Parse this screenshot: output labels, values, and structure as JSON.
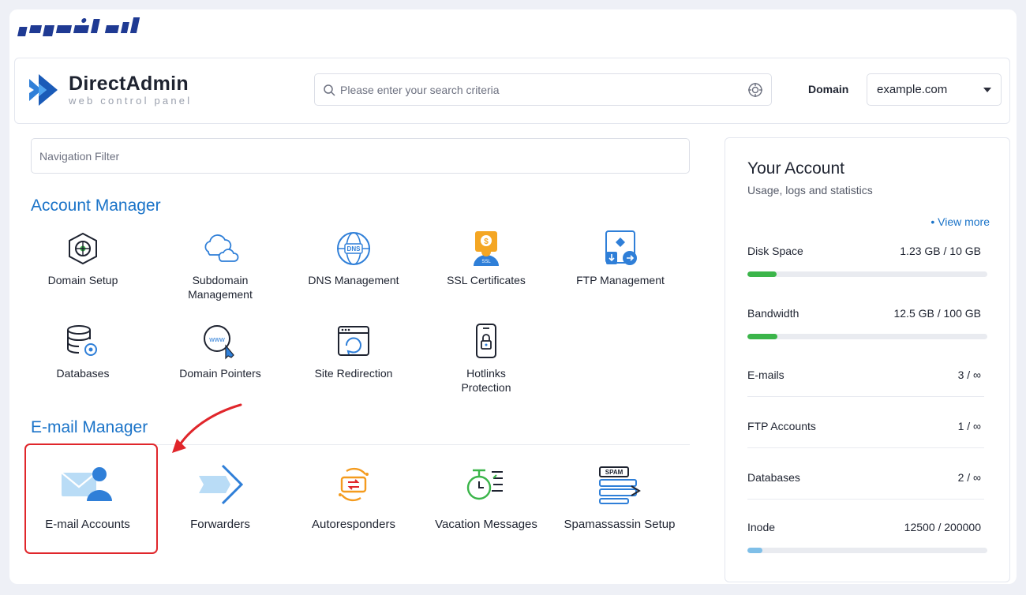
{
  "brand": {
    "logo_text": "ایران سرور"
  },
  "header": {
    "app_name": "DirectAdmin",
    "app_subtitle": "web control panel",
    "search_placeholder": "Please enter your search criteria",
    "domain_label": "Domain",
    "domain_value": "example.com"
  },
  "nav_filter_placeholder": "Navigation Filter",
  "account_manager": {
    "title": "Account Manager",
    "items": [
      {
        "label": "Domain Setup",
        "icon": "domain-setup-icon"
      },
      {
        "label": "Subdomain Management",
        "icon": "cloud-icon"
      },
      {
        "label": "DNS Management",
        "icon": "dns-globe-icon"
      },
      {
        "label": "SSL Certificates",
        "icon": "ssl-certificate-icon"
      },
      {
        "label": "FTP Management",
        "icon": "ftp-transfer-icon"
      },
      {
        "label": "Databases",
        "icon": "database-icon"
      },
      {
        "label": "Domain Pointers",
        "icon": "www-pointer-icon"
      },
      {
        "label": "Site Redirection",
        "icon": "redirect-icon"
      },
      {
        "label": "Hotlinks Protection",
        "icon": "lock-phone-icon"
      }
    ]
  },
  "email_manager": {
    "title": "E-mail Manager",
    "items": [
      {
        "label": "E-mail Accounts",
        "icon": "email-accounts-icon"
      },
      {
        "label": "Forwarders",
        "icon": "forward-arrow-icon"
      },
      {
        "label": "Autoresponders",
        "icon": "autoresponder-icon"
      },
      {
        "label": "Vacation Messages",
        "icon": "vacation-clock-icon"
      },
      {
        "label": "Spamassassin Setup",
        "icon": "spam-filter-icon"
      }
    ]
  },
  "your_account": {
    "title": "Your Account",
    "subtitle": "Usage, logs and statistics",
    "view_more": "• View more",
    "stats": [
      {
        "label": "Disk Space",
        "value": "1.23 GB / 10 GB",
        "usage_fraction": 0.123
      },
      {
        "label": "Bandwidth",
        "value": "12.5 GB / 100 GB",
        "usage_fraction": 0.125
      },
      {
        "label": "E-mails",
        "value": "3 / ∞"
      },
      {
        "label": "FTP Accounts",
        "value": "1 / ∞"
      },
      {
        "label": "Databases",
        "value": "2 / ∞"
      },
      {
        "label": "Inode",
        "value": "12500 / 200000",
        "usage_fraction": 0.0625
      }
    ]
  },
  "colors": {
    "accent": "#1a73c8",
    "highlight": "#e0262b",
    "bar_fill": "#3bb54a"
  }
}
